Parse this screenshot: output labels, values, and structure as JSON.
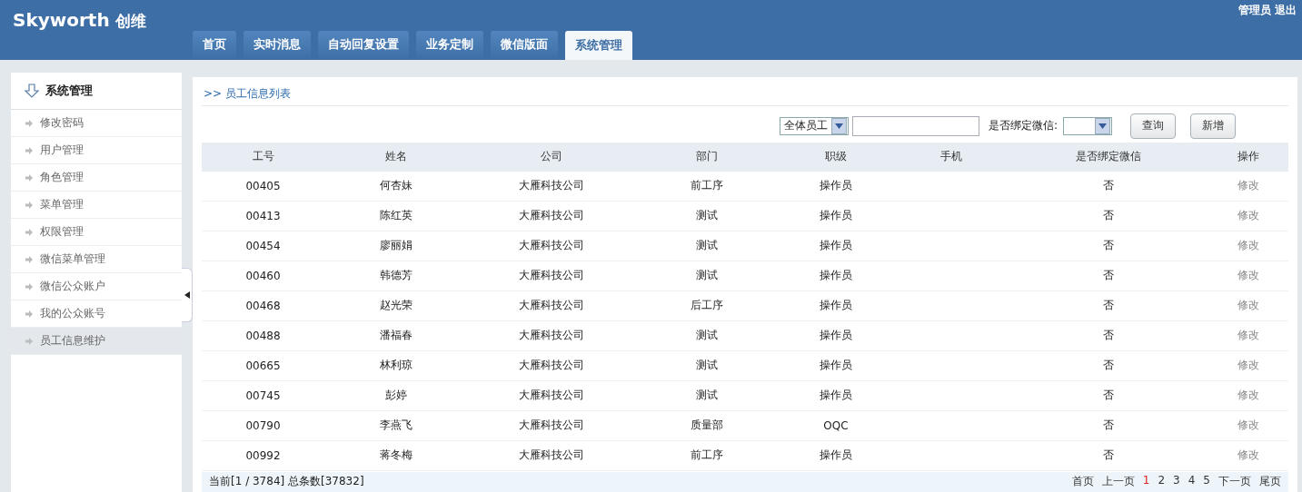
{
  "header": {
    "logo": "Skyworth",
    "logo_cn": "创维",
    "user": "管理员",
    "logout": "退出"
  },
  "tabs": [
    {
      "label": "首页",
      "selected": false
    },
    {
      "label": "实时消息",
      "selected": false
    },
    {
      "label": "自动回复设置",
      "selected": false
    },
    {
      "label": "业务定制",
      "selected": false
    },
    {
      "label": "微信版面",
      "selected": false
    },
    {
      "label": "系统管理",
      "selected": true
    }
  ],
  "sidebar": {
    "title": "系统管理",
    "items": [
      {
        "label": "修改密码",
        "selected": false
      },
      {
        "label": "用户管理",
        "selected": false
      },
      {
        "label": "角色管理",
        "selected": false
      },
      {
        "label": "菜单管理",
        "selected": false
      },
      {
        "label": "权限管理",
        "selected": false
      },
      {
        "label": "微信菜单管理",
        "selected": false
      },
      {
        "label": "微信公众账户",
        "selected": false
      },
      {
        "label": "我的公众账号",
        "selected": false
      },
      {
        "label": "员工信息维护",
        "selected": true
      }
    ]
  },
  "breadcrumb": ">> 员工信息列表",
  "toolbar": {
    "filter": "全体员工",
    "bind_label": "是否绑定微信:",
    "buttons": [
      "查询",
      "新增"
    ]
  },
  "table": {
    "columns": [
      "工号",
      "姓名",
      "公司",
      "部门",
      "职级",
      "手机",
      "是否绑定微信",
      "操作"
    ],
    "rows": [
      [
        "00405",
        "何杏妹",
        "大雁科技公司",
        "前工序",
        "操作员",
        "",
        "否",
        "修改"
      ],
      [
        "00413",
        "陈红英",
        "大雁科技公司",
        "测试",
        "操作员",
        "",
        "否",
        "修改"
      ],
      [
        "00454",
        "廖丽娟",
        "大雁科技公司",
        "测试",
        "操作员",
        "",
        "否",
        "修改"
      ],
      [
        "00460",
        "韩德芳",
        "大雁科技公司",
        "测试",
        "操作员",
        "",
        "否",
        "修改"
      ],
      [
        "00468",
        "赵光荣",
        "大雁科技公司",
        "后工序",
        "操作员",
        "",
        "否",
        "修改"
      ],
      [
        "00488",
        "潘福春",
        "大雁科技公司",
        "测试",
        "操作员",
        "",
        "否",
        "修改"
      ],
      [
        "00665",
        "林利琼",
        "大雁科技公司",
        "测试",
        "操作员",
        "",
        "否",
        "修改"
      ],
      [
        "00745",
        "彭婷",
        "大雁科技公司",
        "测试",
        "操作员",
        "",
        "否",
        "修改"
      ],
      [
        "00790",
        "李燕飞",
        "大雁科技公司",
        "质量部",
        "OQC",
        "",
        "否",
        "修改"
      ],
      [
        "00992",
        "蒋冬梅",
        "大雁科技公司",
        "前工序",
        "操作员",
        "",
        "否",
        "修改"
      ]
    ]
  },
  "footer": {
    "summary": "当前[1 / 3784] 总条数[37832]",
    "pages": [
      {
        "label": "首页",
        "selected": false
      },
      {
        "label": "上一页",
        "selected": false
      },
      {
        "label": "1",
        "selected": true
      },
      {
        "label": "2",
        "selected": false
      },
      {
        "label": "3",
        "selected": false
      },
      {
        "label": "4",
        "selected": false
      },
      {
        "label": "5",
        "selected": false
      },
      {
        "label": "下一页",
        "selected": false
      },
      {
        "label": "尾页",
        "selected": false
      }
    ]
  }
}
